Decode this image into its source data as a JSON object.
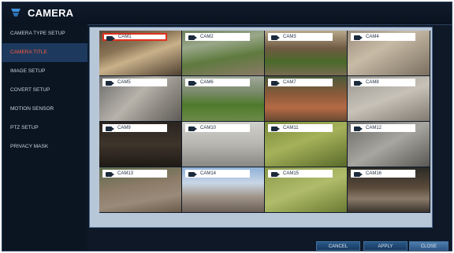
{
  "window": {
    "title": "CAMERA"
  },
  "sidebar": {
    "items": [
      {
        "label": "CAMERA TYPE SETUP",
        "active": false
      },
      {
        "label": "CAMERA TITLE",
        "active": true
      },
      {
        "label": "IMAGE SETUP",
        "active": false
      },
      {
        "label": "COVERT SETUP",
        "active": false
      },
      {
        "label": "MOTION SENSOR",
        "active": false
      },
      {
        "label": "PTZ SETUP",
        "active": false
      },
      {
        "label": "PRIVACY MASK",
        "active": false
      }
    ]
  },
  "cameras": [
    {
      "label": "CAM1",
      "selected": true,
      "icon": "camera-icon",
      "scene": "indoor-wood"
    },
    {
      "label": "CAM2",
      "selected": false,
      "icon": "camera-icon",
      "scene": "garden-path"
    },
    {
      "label": "CAM3",
      "selected": false,
      "icon": "camera-icon",
      "scene": "courtyard"
    },
    {
      "label": "CAM4",
      "selected": false,
      "icon": "camera-icon",
      "scene": "room-light"
    },
    {
      "label": "CAM5",
      "selected": false,
      "icon": "camera-icon",
      "scene": "hallway"
    },
    {
      "label": "CAM6",
      "selected": false,
      "icon": "camera-icon",
      "scene": "lawn"
    },
    {
      "label": "CAM7",
      "selected": false,
      "icon": "camera-icon",
      "scene": "brick-path"
    },
    {
      "label": "CAM8",
      "selected": false,
      "icon": "camera-icon",
      "scene": "room-grey"
    },
    {
      "label": "CAM9",
      "selected": false,
      "icon": "camera-icon",
      "scene": "dark-corridor"
    },
    {
      "label": "CAM10",
      "selected": false,
      "icon": "camera-icon",
      "scene": "wall-light"
    },
    {
      "label": "CAM11",
      "selected": false,
      "icon": "camera-icon",
      "scene": "green-room"
    },
    {
      "label": "CAM12",
      "selected": false,
      "icon": "camera-icon",
      "scene": "ceiling"
    },
    {
      "label": "CAM13",
      "selected": false,
      "icon": "camera-icon",
      "scene": "street"
    },
    {
      "label": "CAM14",
      "selected": false,
      "icon": "camera-icon",
      "scene": "building"
    },
    {
      "label": "CAM15",
      "selected": false,
      "icon": "camera-icon",
      "scene": "green-door"
    },
    {
      "label": "CAM16",
      "selected": false,
      "icon": "camera-icon",
      "scene": "dark-stairs"
    }
  ],
  "buttons": {
    "cancel": "CANCEL",
    "apply": "APPLY",
    "close": "CLOSE"
  },
  "colors": {
    "background": "#0e1826",
    "active_item_bg": "#1d3a5e",
    "active_item_text": "#ff5a3c",
    "selected_border": "#e0301c"
  }
}
